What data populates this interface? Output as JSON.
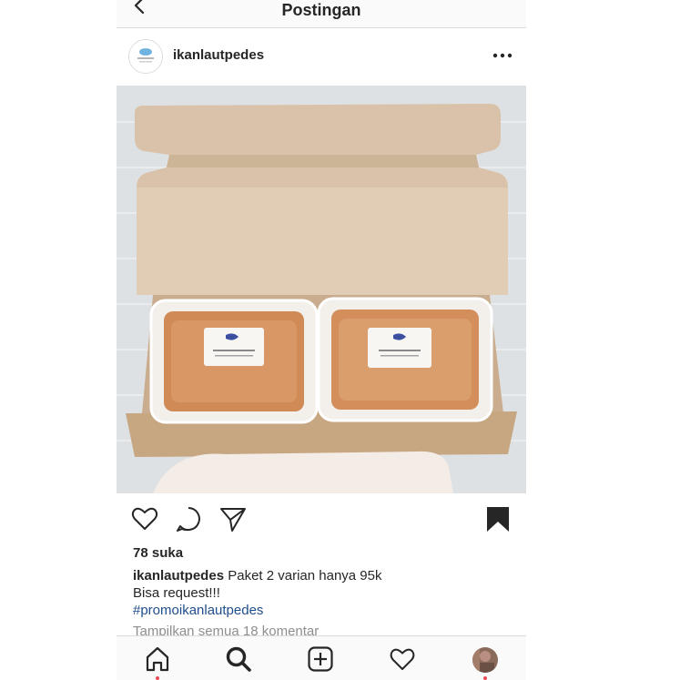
{
  "topbar": {
    "title": "Postingan",
    "back_icon": "chevron-left-icon"
  },
  "post": {
    "username": "ikanlautpedes",
    "more_icon": "more-horizontal-icon",
    "photo_description_icon": "product-photo"
  },
  "actions": {
    "like_icon": "heart-icon",
    "comment_icon": "comment-icon",
    "share_icon": "send-icon",
    "save_icon": "bookmark-icon"
  },
  "likes": "78 suka",
  "caption": {
    "username": "ikanlautpedes",
    "line1": "Paket 2 varian hanya 95k",
    "line2": "Bisa request!!!",
    "hashtag": "#promoikanlautpedes"
  },
  "comments_link": "Tampilkan semua 18 komentar",
  "nav": {
    "home_icon": "home-icon",
    "search_icon": "search-icon",
    "add_icon": "add-post-icon",
    "activity_icon": "heart-icon",
    "profile_icon": "profile-avatar-icon"
  },
  "colors": {
    "notification": "#ed4956",
    "hashtag": "#1f4e8c"
  }
}
